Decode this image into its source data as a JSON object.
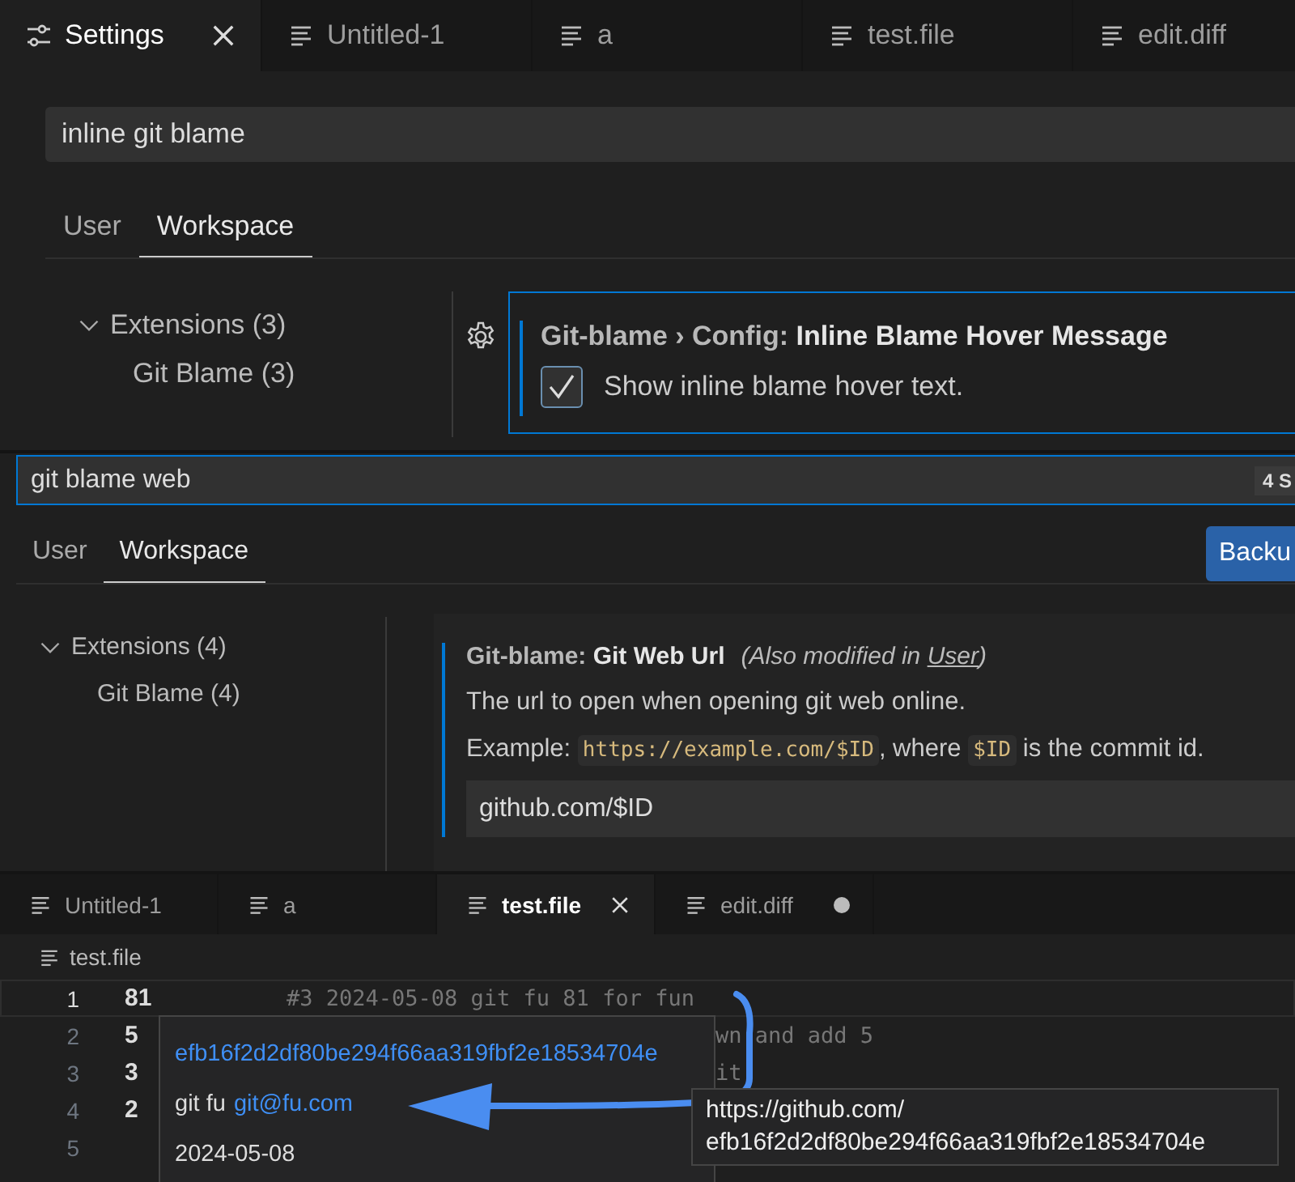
{
  "top_settings": {
    "tabs": [
      {
        "label": "Settings",
        "kind": "settings",
        "selected": true,
        "closable": true
      },
      {
        "label": "Untitled-1",
        "kind": "file",
        "selected": false,
        "closable": false
      },
      {
        "label": "a",
        "kind": "file",
        "selected": false,
        "closable": false
      },
      {
        "label": "test.file",
        "kind": "file",
        "selected": false,
        "closable": false
      },
      {
        "label": "edit.diff",
        "kind": "file",
        "selected": false,
        "closable": false
      }
    ],
    "search": {
      "value": "inline git blame"
    },
    "scopes": [
      {
        "label": "User",
        "selected": false
      },
      {
        "label": "Workspace",
        "selected": true
      }
    ],
    "tree": [
      {
        "label": "Extensions (3)",
        "expanded": true,
        "children": [
          {
            "label": "Git Blame (3)"
          }
        ]
      }
    ],
    "setting": {
      "focused": true,
      "title": "Git-blame › Config: **Inline Blame Hover Message**",
      "checkbox": {
        "label": "Show inline blame hover text.",
        "checked": true
      }
    }
  },
  "middle_settings": {
    "search": {
      "value": "git blame web",
      "result_count": "4 S"
    },
    "scopes": [
      {
        "label": "User",
        "selected": false
      },
      {
        "label": "Workspace",
        "selected": true
      }
    ],
    "action_button": "Backu",
    "tree": [
      {
        "label": "Extensions (4)",
        "expanded": true,
        "children": [
          {
            "label": "Git Blame (4)"
          }
        ]
      }
    ],
    "setting": {
      "focused": false,
      "title": "Git-blame: **Git Web Url**",
      "note_before": "(Also modified in ",
      "note_link": "User",
      "note_after": ")",
      "description": "The url to open when opening git web online.",
      "example": [
        {
          "kind": "text",
          "text": "Example: "
        },
        {
          "kind": "code",
          "text": "https://example.com/$ID"
        },
        {
          "kind": "text",
          "text": ", where "
        },
        {
          "kind": "code",
          "text": "$ID"
        },
        {
          "kind": "text",
          "text": " is the commit id."
        }
      ],
      "value": "github.com/$ID"
    }
  },
  "editor": {
    "tabs": [
      {
        "label": "Untitled-1",
        "selected": false,
        "closable": false,
        "dirty": false
      },
      {
        "label": "a",
        "selected": false,
        "closable": false,
        "dirty": false
      },
      {
        "label": "test.file",
        "selected": true,
        "closable": true,
        "dirty": false
      },
      {
        "label": "edit.diff",
        "selected": false,
        "closable": false,
        "dirty": true
      }
    ],
    "breadcrumb": "test.file",
    "lines": [
      {
        "number": "1",
        "text": "81",
        "current": true,
        "blame": "#3 2024-05-08 git fu 81 for fun",
        "clipped": false
      },
      {
        "number": "2",
        "text": "5",
        "current": false,
        "blame": "wn and add 5",
        "clipped": true
      },
      {
        "number": "3",
        "text": "3",
        "current": false,
        "blame": "it",
        "clipped": true
      },
      {
        "number": "4",
        "text": "2",
        "current": false
      },
      {
        "number": "5",
        "current": false
      }
    ],
    "hover": {
      "hash": "efb16f2d2df80be294f66aa319fbf2e18534704e",
      "author": "git fu",
      "email": "git@fu.com",
      "date": "2024-05-08"
    },
    "tooltip": {
      "lines": [
        "https://github.com/",
        "efb16f2d2df80be294f66aa319fbf2e18534704e"
      ]
    }
  }
}
